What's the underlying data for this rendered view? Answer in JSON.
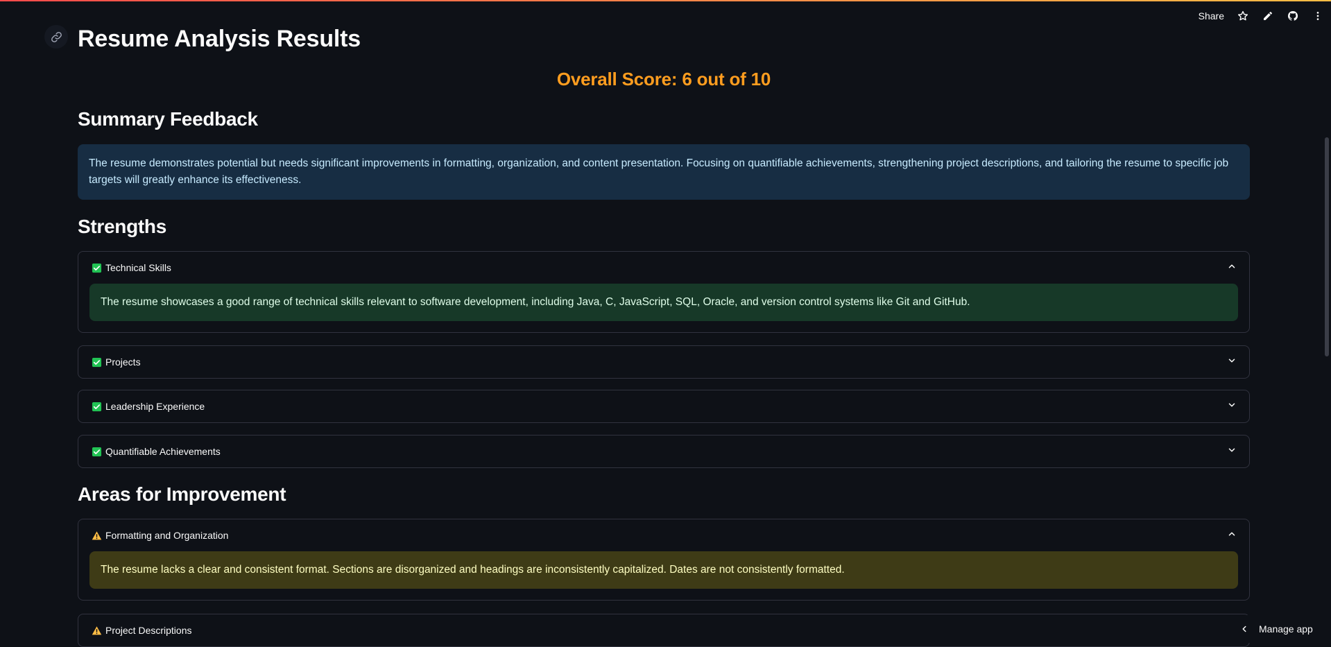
{
  "header": {
    "share_label": "Share",
    "icons": [
      "star-icon",
      "pencil-icon",
      "github-icon",
      "more-vertical-icon"
    ]
  },
  "page": {
    "title": "Resume Analysis Results",
    "score_text": "Overall Score: 6 out of 10"
  },
  "summary": {
    "heading": "Summary Feedback",
    "text": "The resume demonstrates potential but needs significant improvements in formatting, organization, and content presentation. Focusing on quantifiable achievements, strengthening project descriptions, and tailoring the resume to specific job targets will greatly enhance its effectiveness."
  },
  "strengths": {
    "heading": "Strengths",
    "items": [
      {
        "label": "Technical Skills",
        "expanded": true,
        "body": "The resume showcases a good range of technical skills relevant to software development, including Java, C, JavaScript, SQL, Oracle, and version control systems like Git and GitHub."
      },
      {
        "label": "Projects",
        "expanded": false
      },
      {
        "label": "Leadership Experience",
        "expanded": false
      },
      {
        "label": "Quantifiable Achievements",
        "expanded": false
      }
    ]
  },
  "improvements": {
    "heading": "Areas for Improvement",
    "items": [
      {
        "label": "Formatting and Organization",
        "expanded": true,
        "body": "The resume lacks a clear and consistent format. Sections are disorganized and headings are inconsistently capitalized. Dates are not consistently formatted."
      },
      {
        "label": "Project Descriptions",
        "expanded": false
      }
    ]
  },
  "footer": {
    "manage_label": "Manage app"
  },
  "colors": {
    "background": "#0e1117",
    "score": "#ff9d1f",
    "info_bg": "#172d43",
    "success_bg": "#173928",
    "warning_bg": "#3e3b16",
    "check": "#21c354",
    "warning_icon": "#ffbd45"
  }
}
